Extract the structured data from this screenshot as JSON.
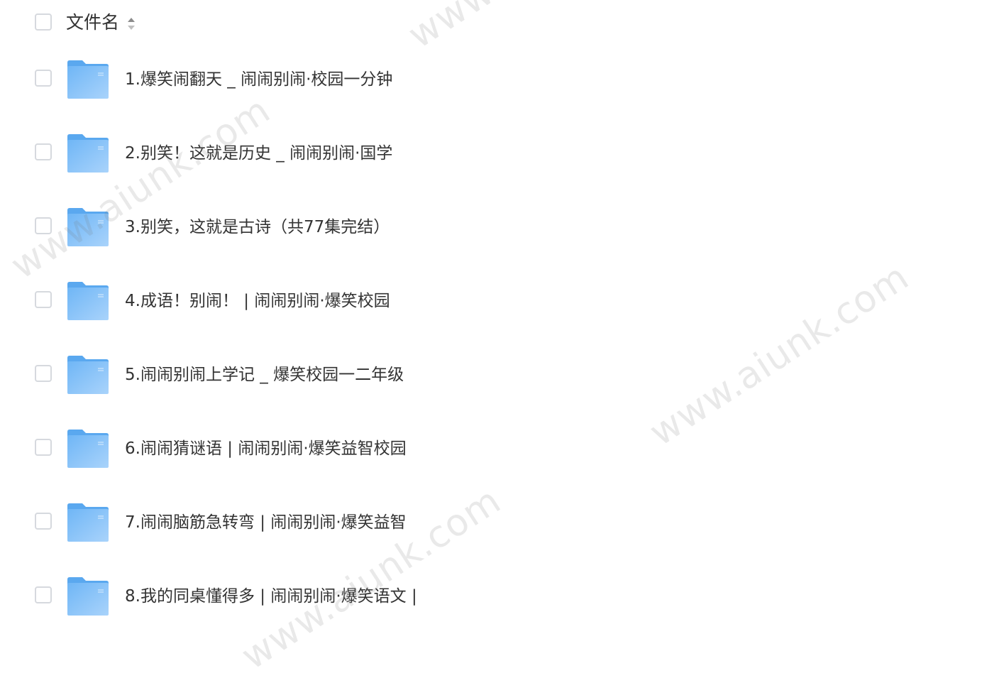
{
  "header": {
    "name_label": "文件名",
    "sort_icon": "sort-updown-icon"
  },
  "files": [
    {
      "name": "1.爆笑闹翻天 _ 闹闹别闹·校园一分钟",
      "icon": "folder-icon"
    },
    {
      "name": "2.别笑！这就是历史 _ 闹闹别闹·国学",
      "icon": "folder-icon"
    },
    {
      "name": "3.别笑，这就是古诗（共77集完结）",
      "icon": "folder-icon"
    },
    {
      "name": "4.成语！别闹！ | 闹闹别闹·爆笑校园",
      "icon": "folder-icon"
    },
    {
      "name": "5.闹闹别闹上学记 _ 爆笑校园一二年级",
      "icon": "folder-icon"
    },
    {
      "name": "6.闹闹猜谜语 | 闹闹别闹·爆笑益智校园",
      "icon": "folder-icon"
    },
    {
      "name": "7.闹闹脑筋急转弯 | 闹闹别闹·爆笑益智",
      "icon": "folder-icon"
    },
    {
      "name": "8.我的同桌懂得多 | 闹闹别闹·爆笑语文 |",
      "icon": "folder-icon"
    }
  ],
  "watermark": {
    "text": "www.aiunk.com"
  },
  "colors": {
    "checkbox_border": "#d6d9de",
    "folder_light": "#a9d3fb",
    "folder_dark": "#6fb6f6",
    "text": "#333333"
  }
}
